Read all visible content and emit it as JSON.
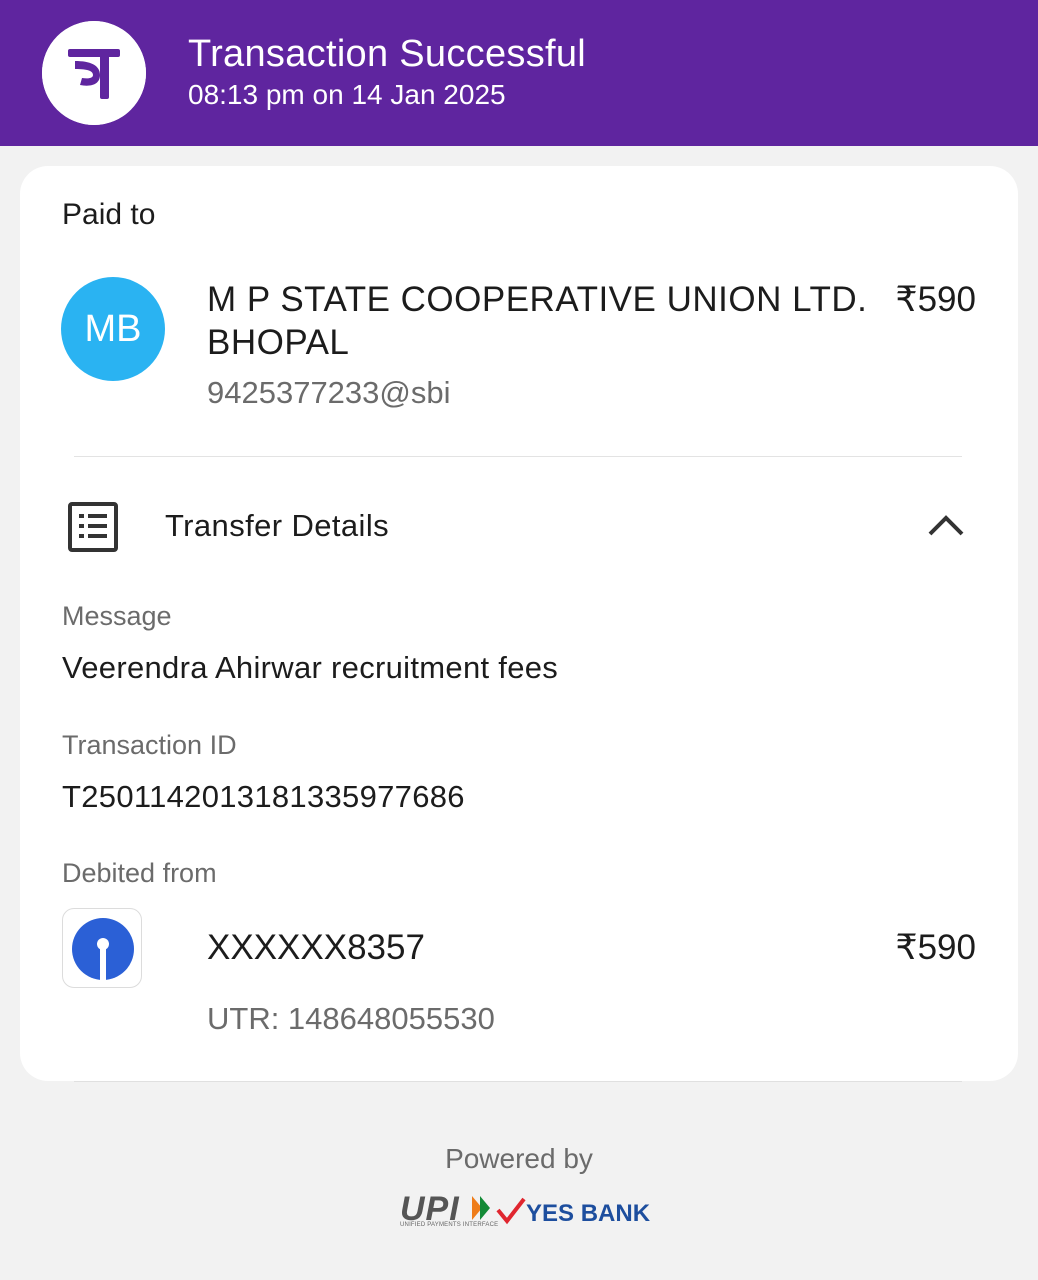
{
  "header": {
    "app_logo_icon": "phonepe-logo-icon",
    "title": "Transaction Successful",
    "subtitle": "08:13 pm on 14 Jan 2025",
    "bg_color": "#5f259f"
  },
  "payee": {
    "section_label": "Paid to",
    "avatar_initials": "MB",
    "avatar_color": "#2ab3f2",
    "name": "M P STATE COOPERATIVE UNION LTD. BHOPAL",
    "amount": "₹590",
    "vpa": "9425377233@sbi"
  },
  "transfer_details": {
    "icon": "receipt-list-icon",
    "label": "Transfer Details",
    "toggle_icon": "chevron-up-icon",
    "message_label": "Message",
    "message_value": "Veerendra Ahirwar recruitment fees",
    "txn_label": "Transaction ID",
    "txn_value": "T2501142013181335977686",
    "debited_label": "Debited from",
    "bank_icon": "sbi-logo-icon",
    "account": "XXXXXX8357",
    "debit_amount": "₹590",
    "utr": "UTR: 148648055530"
  },
  "footer": {
    "powered_by": "Powered by",
    "upi_logo": "UPI",
    "upi_tagline": "UNIFIED PAYMENTS INTERFACE",
    "bank_logo": "YES BANK"
  }
}
